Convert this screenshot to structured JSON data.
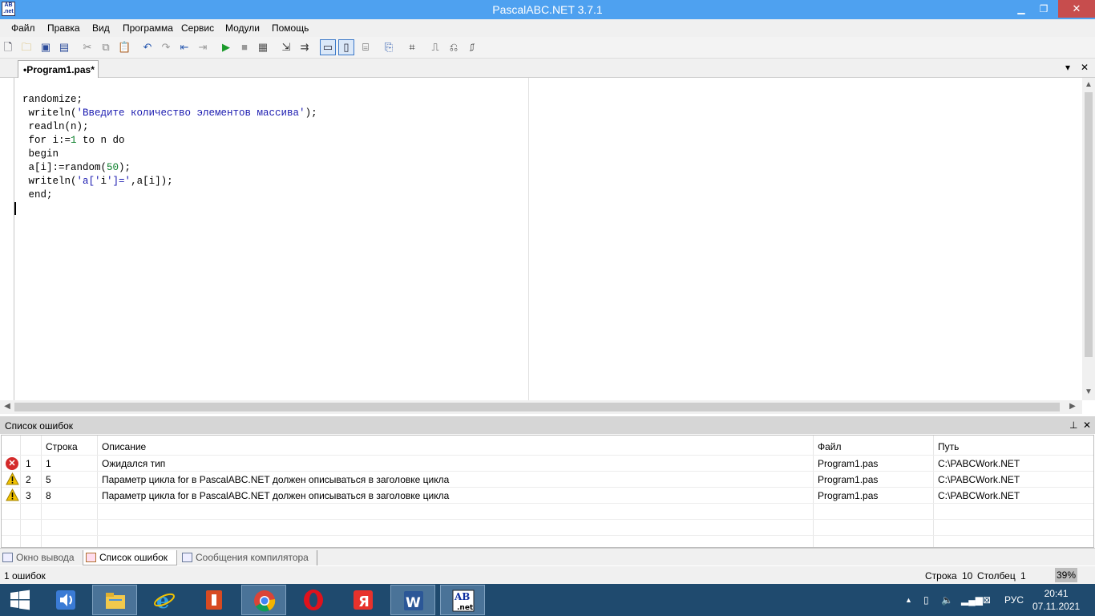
{
  "window": {
    "title": "PascalABC.NET 3.7.1",
    "logo_text": "AB\nnet",
    "controls": {
      "minimize": "▁",
      "maximize": "❐",
      "close": "✕"
    }
  },
  "menu": [
    "Файл",
    "Правка",
    "Вид",
    "Программа",
    "Сервис",
    "Модули",
    "Помощь"
  ],
  "toolbar": {
    "icons": [
      "new-file-icon",
      "open-folder-icon",
      "save-icon",
      "save-all-icon",
      "cut-icon",
      "copy-icon",
      "paste-icon",
      "undo-icon",
      "redo-icon",
      "indent-icon",
      "outdent-icon",
      "run-icon",
      "stop-icon",
      "compile-icon",
      "step-over-icon",
      "step-into-icon",
      "output-window-toggle-icon",
      "editor-toggle-icon",
      "code-template-icon",
      "format-code-icon",
      "code-icon",
      "debug-icon",
      "debug-step-icon",
      "debug-run-icon"
    ]
  },
  "editor_tab": {
    "label": "•Program1.pas*",
    "menu_glyph": "▾",
    "close_glyph": "✕"
  },
  "code": {
    "lines": [
      {
        "parts": [
          {
            "t": "randomize;",
            "c": "plain"
          }
        ]
      },
      {
        "parts": [
          {
            "t": " writeln(",
            "c": "plain"
          },
          {
            "t": "'Введите количество элементов массива'",
            "c": "str"
          },
          {
            "t": ");",
            "c": "plain"
          }
        ]
      },
      {
        "parts": [
          {
            "t": " readln(n);",
            "c": "plain"
          }
        ]
      },
      {
        "parts": [
          {
            "t": " for i:=",
            "c": "plain"
          },
          {
            "t": "1",
            "c": "num"
          },
          {
            "t": " to n do",
            "c": "plain"
          }
        ]
      },
      {
        "parts": [
          {
            "t": " begin",
            "c": "plain"
          }
        ]
      },
      {
        "parts": [
          {
            "t": " a[i]:=random(",
            "c": "plain"
          },
          {
            "t": "50",
            "c": "num"
          },
          {
            "t": ");",
            "c": "plain"
          }
        ]
      },
      {
        "parts": [
          {
            "t": " writeln(",
            "c": "plain"
          },
          {
            "t": "'a['",
            "c": "str"
          },
          {
            "t": "i",
            "c": "plain"
          },
          {
            "t": "']='",
            "c": "str"
          },
          {
            "t": ",a[i]);",
            "c": "plain"
          }
        ]
      },
      {
        "parts": [
          {
            "t": " end;",
            "c": "plain"
          }
        ]
      }
    ]
  },
  "error_panel": {
    "title": "Список ошибок",
    "pin_glyph": "⊥",
    "close_glyph": "✕",
    "columns": [
      "",
      "",
      "Строка",
      "Описание",
      "Файл",
      "Путь"
    ],
    "rows": [
      {
        "kind": "error",
        "num": "1",
        "line": "1",
        "desc": "Ожидался тип",
        "file": "Program1.pas",
        "path": "C:\\PABCWork.NET"
      },
      {
        "kind": "warning",
        "num": "2",
        "line": "5",
        "desc": "Параметр цикла for в PascalABC.NET должен описываться в заголовке цикла",
        "file": "Program1.pas",
        "path": "C:\\PABCWork.NET"
      },
      {
        "kind": "warning",
        "num": "3",
        "line": "8",
        "desc": "Параметр цикла for в PascalABC.NET должен описываться в заголовке цикла",
        "file": "Program1.pas",
        "path": "C:\\PABCWork.NET"
      }
    ]
  },
  "bottom_tabs": [
    {
      "label": "Окно вывода",
      "active": false
    },
    {
      "label": "Список ошибок",
      "active": true
    },
    {
      "label": "Сообщения компилятора",
      "active": false
    }
  ],
  "status": {
    "errors": "1 ошибок",
    "row_label": "Строка",
    "row": "10",
    "col_label": "Столбец",
    "col": "1",
    "zoom": "39%"
  },
  "taskbar": {
    "apps": [
      "windows-start-icon",
      "speaker-app-icon",
      "file-explorer-icon",
      "internet-explorer-icon",
      "office-app-icon",
      "chrome-icon",
      "opera-icon",
      "yandex-browser-icon",
      "word-icon",
      "pascalabc-icon"
    ],
    "tray_lang": "РУС",
    "time": "20:41",
    "date": "07.11.2021"
  },
  "colors": {
    "titlebar": "#4ea1f0",
    "taskbar": "#1f4a6e",
    "string": "#1b1bb0",
    "number": "#0a7f2a",
    "error": "#d42a2a",
    "warning": "#f2c200"
  }
}
